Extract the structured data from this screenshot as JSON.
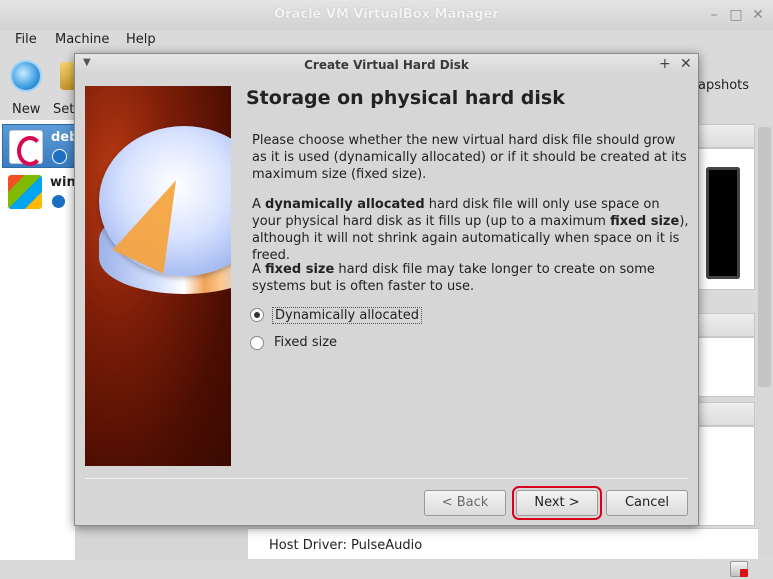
{
  "main_window": {
    "title": "Oracle VM VirtualBox Manager",
    "menu": [
      "File",
      "Machine",
      "Help"
    ],
    "toolbar": {
      "new_label": "New",
      "settings_label_partial": "Set",
      "snapshots_label_partial": "apshots"
    },
    "vm_list": [
      {
        "name_partial": "deb",
        "os_icon": "debian-icon",
        "selected": true
      },
      {
        "name_partial": "win",
        "os_icon": "windows7-icon",
        "selected": false
      }
    ],
    "detail": {
      "key": "Host Driver:",
      "value": "PulseAudio"
    }
  },
  "dialog": {
    "title": "Create Virtual Hard Disk",
    "heading": "Storage on physical hard disk",
    "para1": "Please choose whether the new virtual hard disk file should grow as it is used (dynamically allocated) or if it should be created at its maximum size (fixed size).",
    "para2": {
      "a": "A ",
      "b1": "dynamically allocated",
      "c": " hard disk file will only use space on your physical hard disk as it fills up (up to a maximum ",
      "b2": "fixed size",
      "d": "), although it will not shrink again automatically when space on it is freed."
    },
    "para3": {
      "a": "A ",
      "b1": "fixed size",
      "c": " hard disk file may take longer to create on some systems but is often faster to use."
    },
    "options": [
      {
        "label": "Dynamically allocated",
        "checked": true
      },
      {
        "label": "Fixed size",
        "checked": false
      }
    ],
    "buttons": {
      "back": "< Back",
      "next": "Next >",
      "cancel": "Cancel"
    },
    "highlight_color": "#d8001c"
  }
}
